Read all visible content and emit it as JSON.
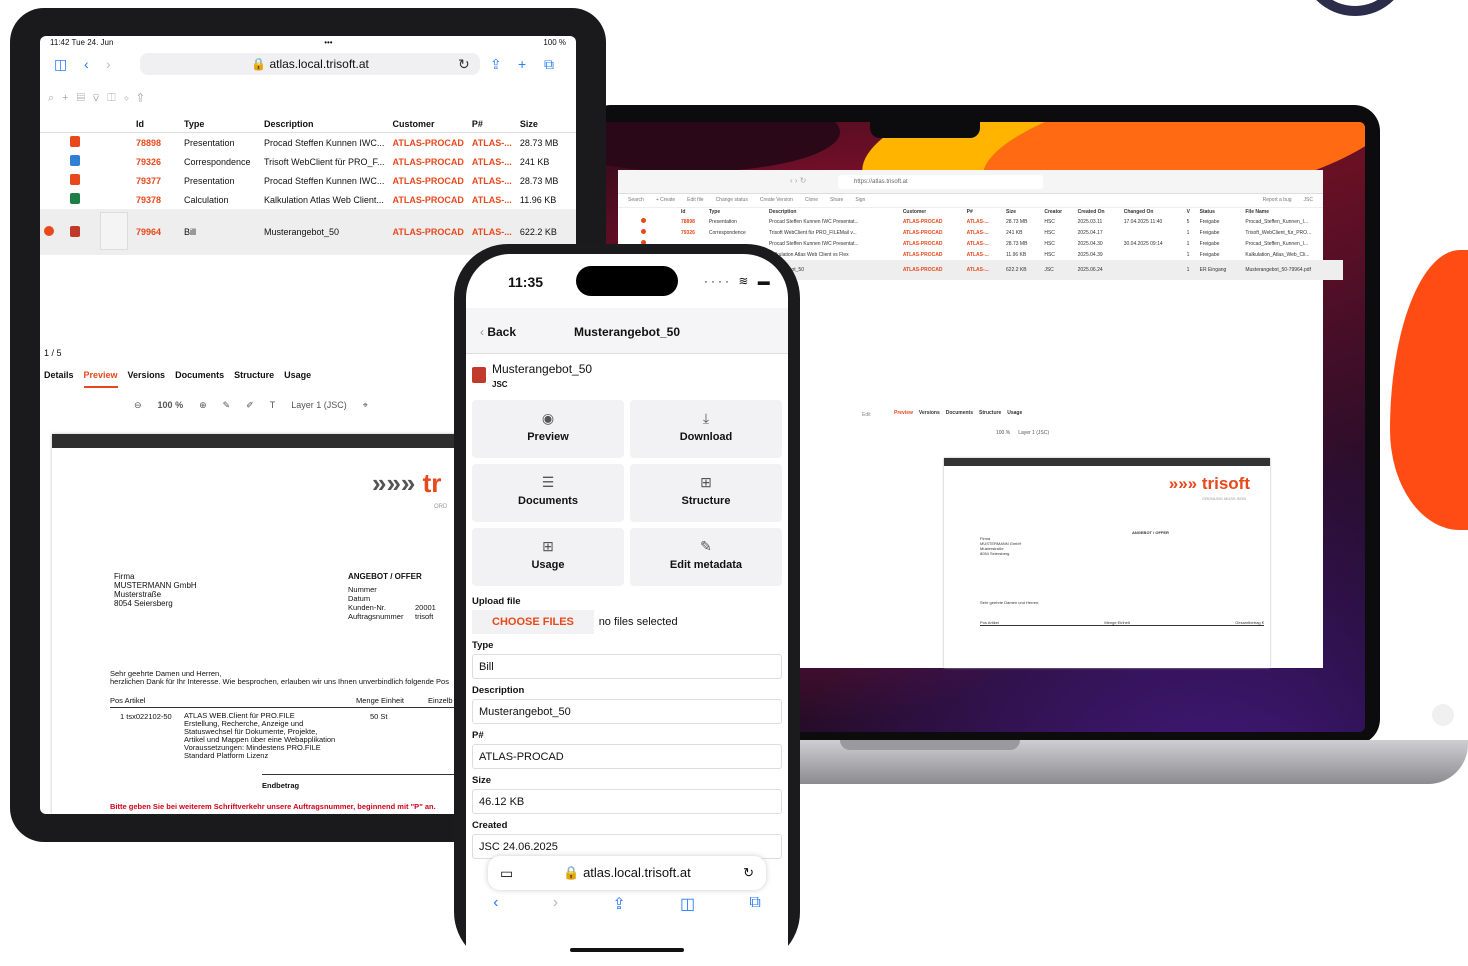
{
  "colors": {
    "accent": "#e8481c",
    "ios_blue": "#2a7cff",
    "blob": "#ff4c14"
  },
  "laptop": {
    "url": "https://atlas.trisoft.at",
    "toolbar": [
      "Search",
      "+ Create",
      "Edit file",
      "Change status",
      "Create Version",
      "Clone",
      "Share",
      "Sign"
    ],
    "toolbar_right": [
      "Report a bug",
      "JSC"
    ],
    "columns": [
      "Id",
      "Type",
      "Description",
      "Customer",
      "P#",
      "Size",
      "Creator",
      "Created On",
      "Changed On",
      "V",
      "Status",
      "File Name"
    ],
    "rows": [
      [
        "78898",
        "Presentation",
        "Procad Steffen Kunnen IWC Presentat...",
        "ATLAS-PROCAD",
        "ATLAS-...",
        "28.73 MB",
        "HSC",
        "2025.03.11",
        "17.04.2025 11:40",
        "5",
        "Freigabe",
        "Procad_Steffen_Kunnen_I..."
      ],
      [
        "79326",
        "Correspondence",
        "Trisoft WebClient für PRO_FILEMail v...",
        "ATLAS-PROCAD",
        "ATLAS-...",
        "241 KB",
        "HSC",
        "2025.04.17",
        "",
        "1",
        "Freigabe",
        "Trisoft_WebClient_für_PRO..."
      ],
      [
        "",
        "",
        "Procad Steffen Kunnen IWC Presentat...",
        "ATLAS-PROCAD",
        "ATLAS-...",
        "28.73 MB",
        "HSC",
        "2025.04.30",
        "30.04.2025 09:14",
        "1",
        "Freigabe",
        "Procad_Steffen_Kunnen_I..."
      ],
      [
        "",
        "",
        "Kalkulation Atlas Web Client vs Flex",
        "ATLAS-PROCAD",
        "ATLAS-...",
        "11.96 KB",
        "HSC",
        "2025.04.39",
        "",
        "1",
        "Freigabe",
        "Kalkulation_Atlas_Web_Cli..."
      ],
      [
        "",
        "",
        "...erangebot_50",
        "ATLAS-PROCAD",
        "ATLAS-...",
        "622.2 KB",
        "JSC",
        "2025.06.24",
        "",
        "1",
        "ER Eingang",
        "Musterangebot_50-79964.pdf"
      ]
    ],
    "edit_label": "Edit",
    "tabs": [
      "Preview",
      "Versions",
      "Documents",
      "Structure",
      "Usage"
    ],
    "zoom": "100 %",
    "layer": "Layer 1 (JSC)",
    "doc": {
      "logo": "trisoft",
      "tagline": "ORDNUNG MUSS SEIN",
      "offer": "ANGEBOT / OFFER",
      "company": [
        "Firma",
        "MUSTERMANN GmbH",
        "Musterstraße",
        "8054 Seiersberg"
      ],
      "salutation": "Sehr geehrte Damen und Herren,",
      "col_pos": "Pos Artikel",
      "col_qty": "Menge Einheit",
      "col_unit": "Einzelbetrag",
      "col_total": "Gesamtbetrag €"
    }
  },
  "tablet": {
    "status_time": "11:42  Tue 24. Jun",
    "status_dots": "•••",
    "status_right": "100 %",
    "url": "atlas.local.trisoft.at",
    "columns": [
      "Id",
      "Type",
      "Description",
      "Customer",
      "P#",
      "Size"
    ],
    "rows": [
      {
        "id": "78898",
        "type": "Presentation",
        "desc": "Procad Steffen Kunnen IWC...",
        "customer": "ATLAS-PROCAD",
        "p": "ATLAS-...",
        "size": "28.73 MB",
        "icon": "#e8481c"
      },
      {
        "id": "79326",
        "type": "Correspondence",
        "desc": "Trisoft WebClient für PRO_F...",
        "customer": "ATLAS-PROCAD",
        "p": "ATLAS-...",
        "size": "241 KB",
        "icon": "#2f7fd6"
      },
      {
        "id": "79377",
        "type": "Presentation",
        "desc": "Procad Steffen Kunnen IWC...",
        "customer": "ATLAS-PROCAD",
        "p": "ATLAS-...",
        "size": "28.73 MB",
        "icon": "#e8481c"
      },
      {
        "id": "79378",
        "type": "Calculation",
        "desc": "Kalkulation Atlas Web Client...",
        "customer": "ATLAS-PROCAD",
        "p": "ATLAS-...",
        "size": "11.96 KB",
        "icon": "#1e7e45"
      },
      {
        "id": "79964",
        "type": "Bill",
        "desc": "Musterangebot_50",
        "customer": "ATLAS-PROCAD",
        "p": "ATLAS-...",
        "size": "622.2 KB",
        "icon": "#c0392b"
      }
    ],
    "pager": "1 / 5",
    "tabs": [
      "Details",
      "Preview",
      "Versions",
      "Documents",
      "Structure",
      "Usage"
    ],
    "zoom": "100 %",
    "layer": "Layer 1 (JSC)",
    "doc": {
      "logo": "tr",
      "tagline": "ORD",
      "company": [
        "Firma",
        "MUSTERMANN GmbH",
        "Musterstraße",
        "8054 Seiersberg"
      ],
      "offer": "ANGEBOT / OFFER",
      "meta_labels": [
        "Nummer",
        "Datum",
        "Kunden-Nr.",
        "Auftragsnummer"
      ],
      "meta_values": [
        "",
        "",
        "20001",
        "trisoft"
      ],
      "salutation": "Sehr geehrte Damen und Herren,",
      "thanks": "herzlichen Dank für Ihr Interesse. Wie besprochen, erlauben wir uns Ihnen unverbindlich folgende Pos",
      "col_pos": "Pos Artikel",
      "col_qty": "Menge Einheit",
      "col_unit": "Einzelb",
      "item_no": "1 tsx022102-50",
      "item_title": "ATLAS WEB.Client für PRO.FILE",
      "item_lines": [
        "Erstellung, Recherche, Anzeige und",
        "Statuswechsel für Dokumente, Projekte,",
        "Artikel und Mappen über eine Webapplikation",
        "Voraussetzungen: Mindestens PRO.FILE",
        "Standard Platform Lizenz"
      ],
      "item_qty": "50 St",
      "total_label": "Endbetrag",
      "footer_red": "Bitte geben Sie bei weiterem Schriftverkehr unsere Auftragsnummer, beginnend mit \"P\" an."
    }
  },
  "phone": {
    "time": "11:35",
    "back": "Back",
    "title": "Musterangebot_50",
    "file_name": "Musterangebot_50",
    "file_sub": "JSC",
    "actions": [
      {
        "label": "Preview",
        "icon": "eye-icon",
        "glyph": "◉"
      },
      {
        "label": "Download",
        "icon": "download-icon",
        "glyph": "⤓"
      },
      {
        "label": "Documents",
        "icon": "list-icon",
        "glyph": "☰"
      },
      {
        "label": "Structure",
        "icon": "tree-icon",
        "glyph": "⊞"
      },
      {
        "label": "Usage",
        "icon": "tree-icon",
        "glyph": "⊞"
      },
      {
        "label": "Edit metadata",
        "icon": "pencil-icon",
        "glyph": "✎"
      }
    ],
    "upload_label": "Upload file",
    "choose_files": "CHOOSE FILES",
    "no_files": "no files selected",
    "fields": [
      {
        "label": "Type",
        "value": "Bill"
      },
      {
        "label": "Description",
        "value": "Musterangebot_50"
      },
      {
        "label": "P#",
        "value": "ATLAS-PROCAD"
      },
      {
        "label": "Size",
        "value": "46.12 KB"
      },
      {
        "label": "Created",
        "value": "JSC 24.06.2025"
      }
    ],
    "url": "atlas.local.trisoft.at"
  }
}
